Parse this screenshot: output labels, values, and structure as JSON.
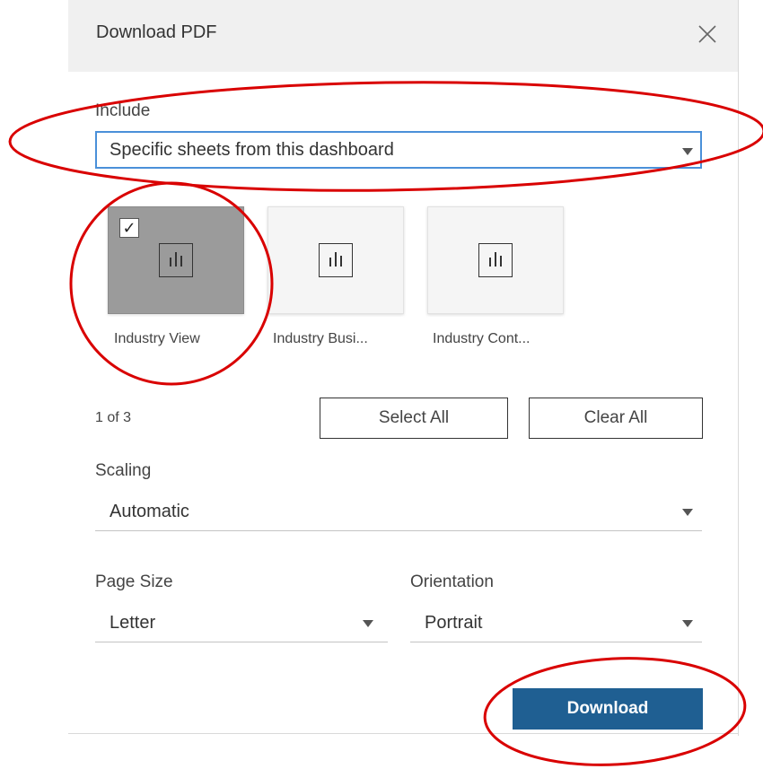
{
  "dialog": {
    "title": "Download PDF",
    "close_icon": "close-icon"
  },
  "include": {
    "label": "Include",
    "value": "Specific sheets from this dashboard"
  },
  "sheets": [
    {
      "label": "Industry View",
      "selected": true,
      "icon": "chart-icon"
    },
    {
      "label": "Industry Busi...",
      "selected": false,
      "icon": "chart-icon"
    },
    {
      "label": "Industry Cont...",
      "selected": false,
      "icon": "chart-icon"
    }
  ],
  "selection": {
    "count": "1 of 3",
    "select_all": "Select All",
    "clear_all": "Clear All"
  },
  "scaling": {
    "label": "Scaling",
    "value": "Automatic"
  },
  "page_size": {
    "label": "Page Size",
    "value": "Letter"
  },
  "orientation": {
    "label": "Orientation",
    "value": "Portrait"
  },
  "actions": {
    "download": "Download"
  },
  "colors": {
    "primary": "#1f5f92",
    "focus_border": "#4a90d9",
    "annotation": "#d90000",
    "selected_thumb": "#9b9b9b"
  }
}
